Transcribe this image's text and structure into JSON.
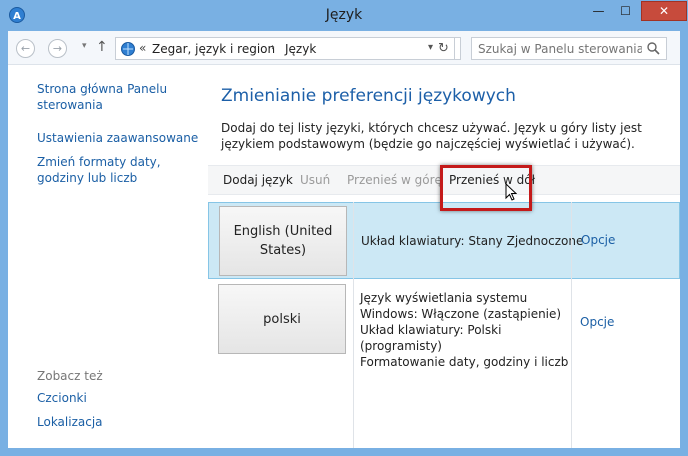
{
  "window": {
    "title": "Język",
    "minimize_glyph": "—",
    "maximize_glyph": "☐",
    "close_glyph": "✕"
  },
  "nav": {
    "back_glyph": "←",
    "forward_glyph": "→",
    "recent_glyph": "▾",
    "up_glyph": "↑",
    "address_chevron": "«",
    "breadcrumb1": "Zegar, język i region",
    "breadcrumb2": "Język",
    "separator": "›",
    "dropdown": "▾",
    "refresh_glyph": "↻",
    "search_placeholder": "Szukaj w Panelu sterowania"
  },
  "sidebar": {
    "home": "Strona główna Panelu sterowania",
    "advanced": "Ustawienia zaawansowane",
    "formats": "Zmień formaty daty, godziny lub liczb",
    "see_also": "Zobacz też",
    "fonts": "Czcionki",
    "location": "Lokalizacja"
  },
  "main": {
    "heading": "Zmienianie preferencji językowych",
    "description": "Dodaj do tej listy języki, których chcesz używać. Język u góry listy jest językiem podstawowym (będzie go najczęściej wyświetlać i używać).",
    "toolbar": {
      "add": "Dodaj język",
      "remove": "Usuń",
      "move_up": "Przenieś w górę",
      "move_down": "Przenieś w dół"
    },
    "languages": [
      {
        "name": "English (United States)",
        "info_line1": "Układ klawiatury: Stany Zjednoczone",
        "options": "Opcje"
      },
      {
        "name": "polski",
        "info_line1": "Język wyświetlania systemu Windows: Włączone (zastąpienie)",
        "info_line2": "Układ klawiatury: Polski (programisty)",
        "info_line3": "Formatowanie daty, godziny i liczb",
        "options": "Opcje"
      }
    ]
  },
  "colors": {
    "accent_link": "#1b5fa5",
    "heading": "#1c5fa8",
    "selected_row": "#cce8f5",
    "highlight_box": "#c41a1a",
    "close_button": "#c74b3c"
  }
}
